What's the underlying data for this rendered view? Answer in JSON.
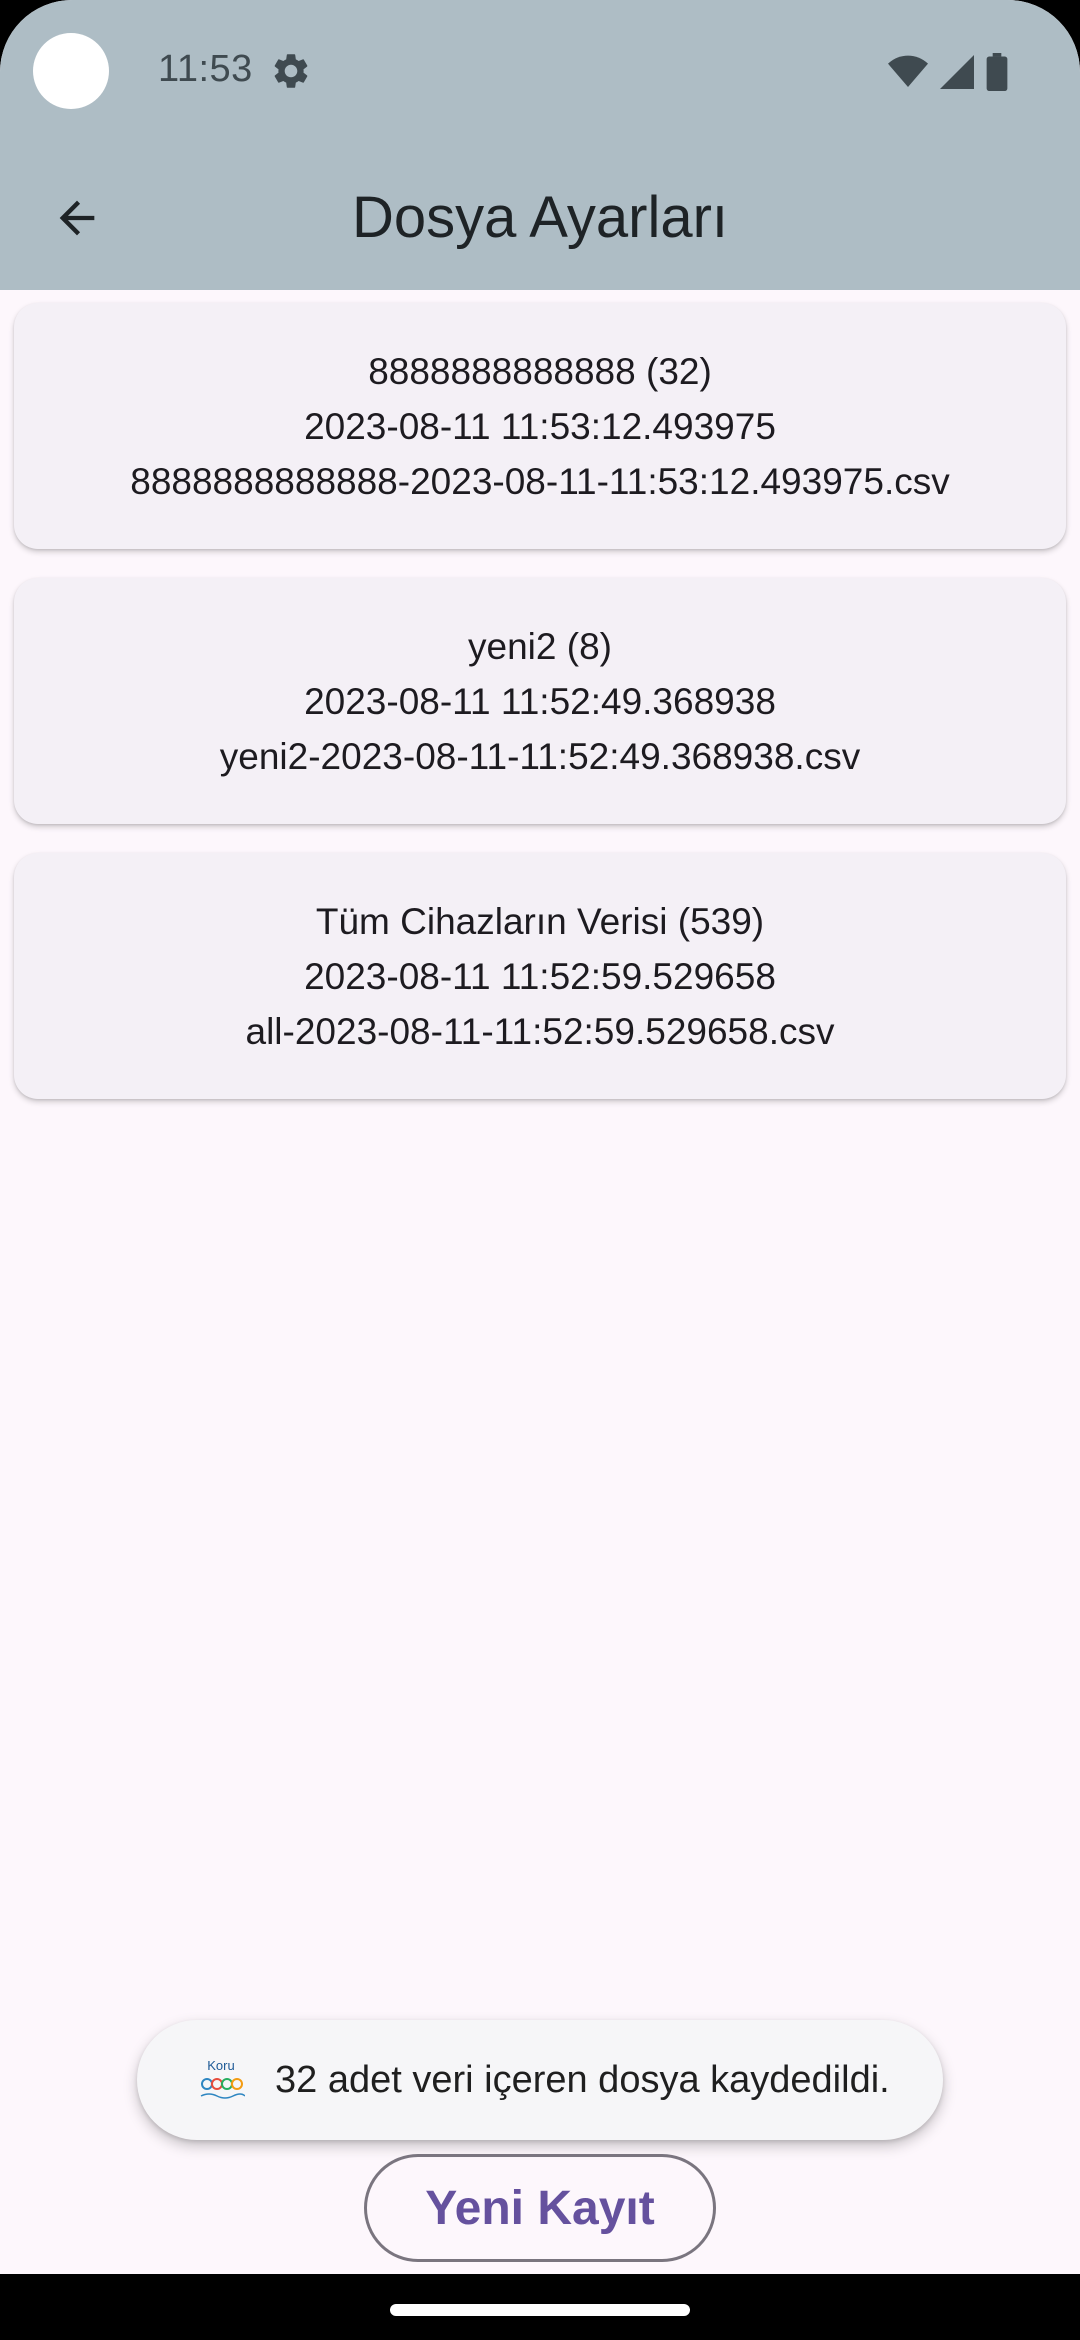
{
  "status_bar": {
    "time": "11:53",
    "icons": [
      "settings-gear-icon",
      "wifi-icon",
      "cellular-signal-icon",
      "battery-icon"
    ]
  },
  "app_bar": {
    "title": "Dosya Ayarları",
    "back_icon": "arrow-back-icon"
  },
  "files": [
    {
      "name": "8888888888888 (32)",
      "timestamp": "2023-08-11 11:53:12.493975",
      "filename": "8888888888888-2023-08-11-11:53:12.493975.csv"
    },
    {
      "name": "yeni2 (8)",
      "timestamp": "2023-08-11 11:52:49.368938",
      "filename": "yeni2-2023-08-11-11:52:49.368938.csv"
    },
    {
      "name": "Tüm Cihazların Verisi (539)",
      "timestamp": "2023-08-11 11:52:59.529658",
      "filename": "all-2023-08-11-11:52:59.529658.csv"
    }
  ],
  "toast": {
    "logo_text": "Koru",
    "message": "32 adet veri içeren dosya kaydedildi."
  },
  "actions": {
    "new_record_label": "Yeni Kayıt"
  },
  "colors": {
    "app_bar_bg": "#AEBDC5",
    "page_bg": "#FDF7FC",
    "card_bg": "#F4F0F6",
    "accent": "#65519E"
  }
}
